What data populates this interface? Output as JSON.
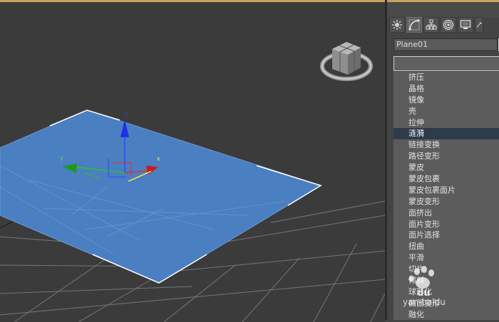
{
  "viewport": {
    "axis_labels": {
      "x": "x",
      "y": "y",
      "z": "z"
    }
  },
  "command_panel": {
    "tabs": [
      {
        "icon": "sun-icon",
        "active": false
      },
      {
        "icon": "curve-icon",
        "active": true
      },
      {
        "icon": "hierarchy-icon",
        "active": false
      },
      {
        "icon": "motion-icon",
        "active": false
      },
      {
        "icon": "display-icon",
        "active": false
      },
      {
        "icon": "utilities-icon",
        "active": false
      }
    ],
    "object_name": "Plane01",
    "object_color": "#d8d8d8",
    "modifier_dropdown_value": "",
    "modifier_list": {
      "selected_index": 5,
      "items": [
        "挤压",
        "晶格",
        "镜像",
        "壳",
        "拉伸",
        "涟漪",
        "链接变换",
        "路径变形",
        "蒙皮",
        "蒙皮包裹",
        "蒙皮包裹面片",
        "蒙皮变形",
        "面挤出",
        "面片变形",
        "面片选择",
        "扭曲",
        "平滑",
        "切片",
        "倾斜",
        "球形化",
        "曲面变形",
        "融化"
      ]
    }
  },
  "watermark": {
    "text": "yan-baidu"
  },
  "colors": {
    "plane": "#4a7fc1",
    "grid": "#8a8a8a",
    "viewport_bg": "#3b3b3b",
    "selection": "#2e3b4a"
  }
}
